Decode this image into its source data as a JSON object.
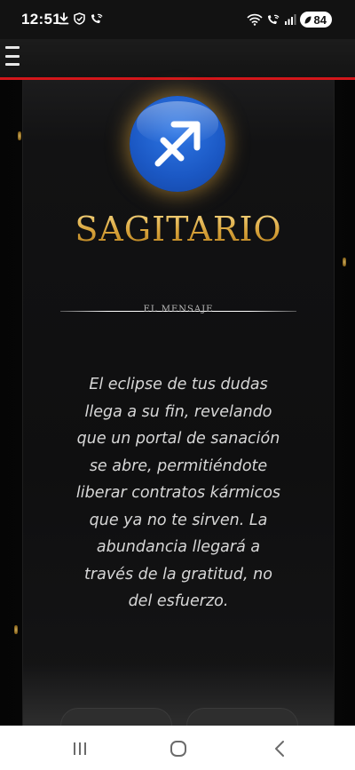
{
  "status_bar": {
    "time": "12:51",
    "battery_level": "84",
    "left_icons": [
      "download-icon",
      "shield-icon",
      "wifi-calling-icon"
    ],
    "right_icons": [
      "wifi-icon",
      "wifi-calling-icon",
      "signal-icon",
      "battery-icon"
    ]
  },
  "header": {
    "menu_icon": "hamburger-menu-icon",
    "accent_color": "#d3161a"
  },
  "sign": {
    "name": "SAGITARIO",
    "icon": "sagittarius-arrow-icon",
    "badge_color": "#1f5fcf",
    "title_color": "#d9a93a"
  },
  "section": {
    "label": "EL MENSAJE"
  },
  "message": {
    "text": "El eclipse de tus dudas llega a su fin, revelando que un portal de sanación se abre, permitiéndote liberar contratos kármicos que ya no te sirven. La abundancia llegará a través de la gratitud, no del esfuerzo."
  },
  "nav_bar": {
    "icons": [
      "recents-icon",
      "home-icon",
      "back-icon"
    ]
  }
}
